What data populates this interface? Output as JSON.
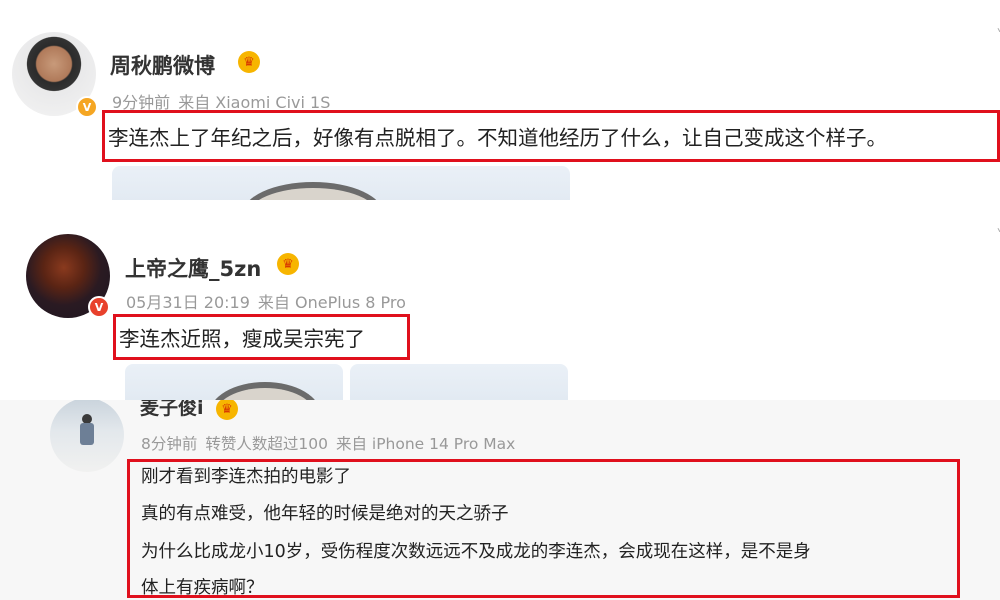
{
  "posts": [
    {
      "author": "周秋鹏微博",
      "time": "9分钟前",
      "source": "来自 Xiaomi Civi 1S",
      "lines": [
        "李连杰上了年纪之后，好像有点脱相了。不知道他经历了什么，让自己变成这个样子。"
      ]
    },
    {
      "author": "上帝之鹰_5zn",
      "time": "05月31日 20:19",
      "source": "来自 OnePlus 8 Pro",
      "lines": [
        "李连杰近照，瘦成吴宗宪了"
      ]
    },
    {
      "author": "麦子俊i",
      "time": "8分钟前",
      "repost": "转赞人数超过100",
      "source": "来自 iPhone 14 Pro Max",
      "lines": [
        "刚才看到李连杰拍的电影了",
        "真的有点难受，他年轻的时候是绝对的天之骄子",
        "为什么比成龙小10岁，受伤程度次数远远不及成龙的李连杰，会成现在这样，是不是身",
        "体上有疾病啊？"
      ]
    }
  ],
  "icons": {
    "member_crown": "crown-icon",
    "verified_badge": "v-badge-icon",
    "more_menu": "chevron-down-icon"
  },
  "colors": {
    "highlight_box": "#e0101d",
    "meta_text": "#999999",
    "crown": "#f7b500",
    "verified_gold": "#f5a623",
    "verified_red": "#e8412c"
  }
}
